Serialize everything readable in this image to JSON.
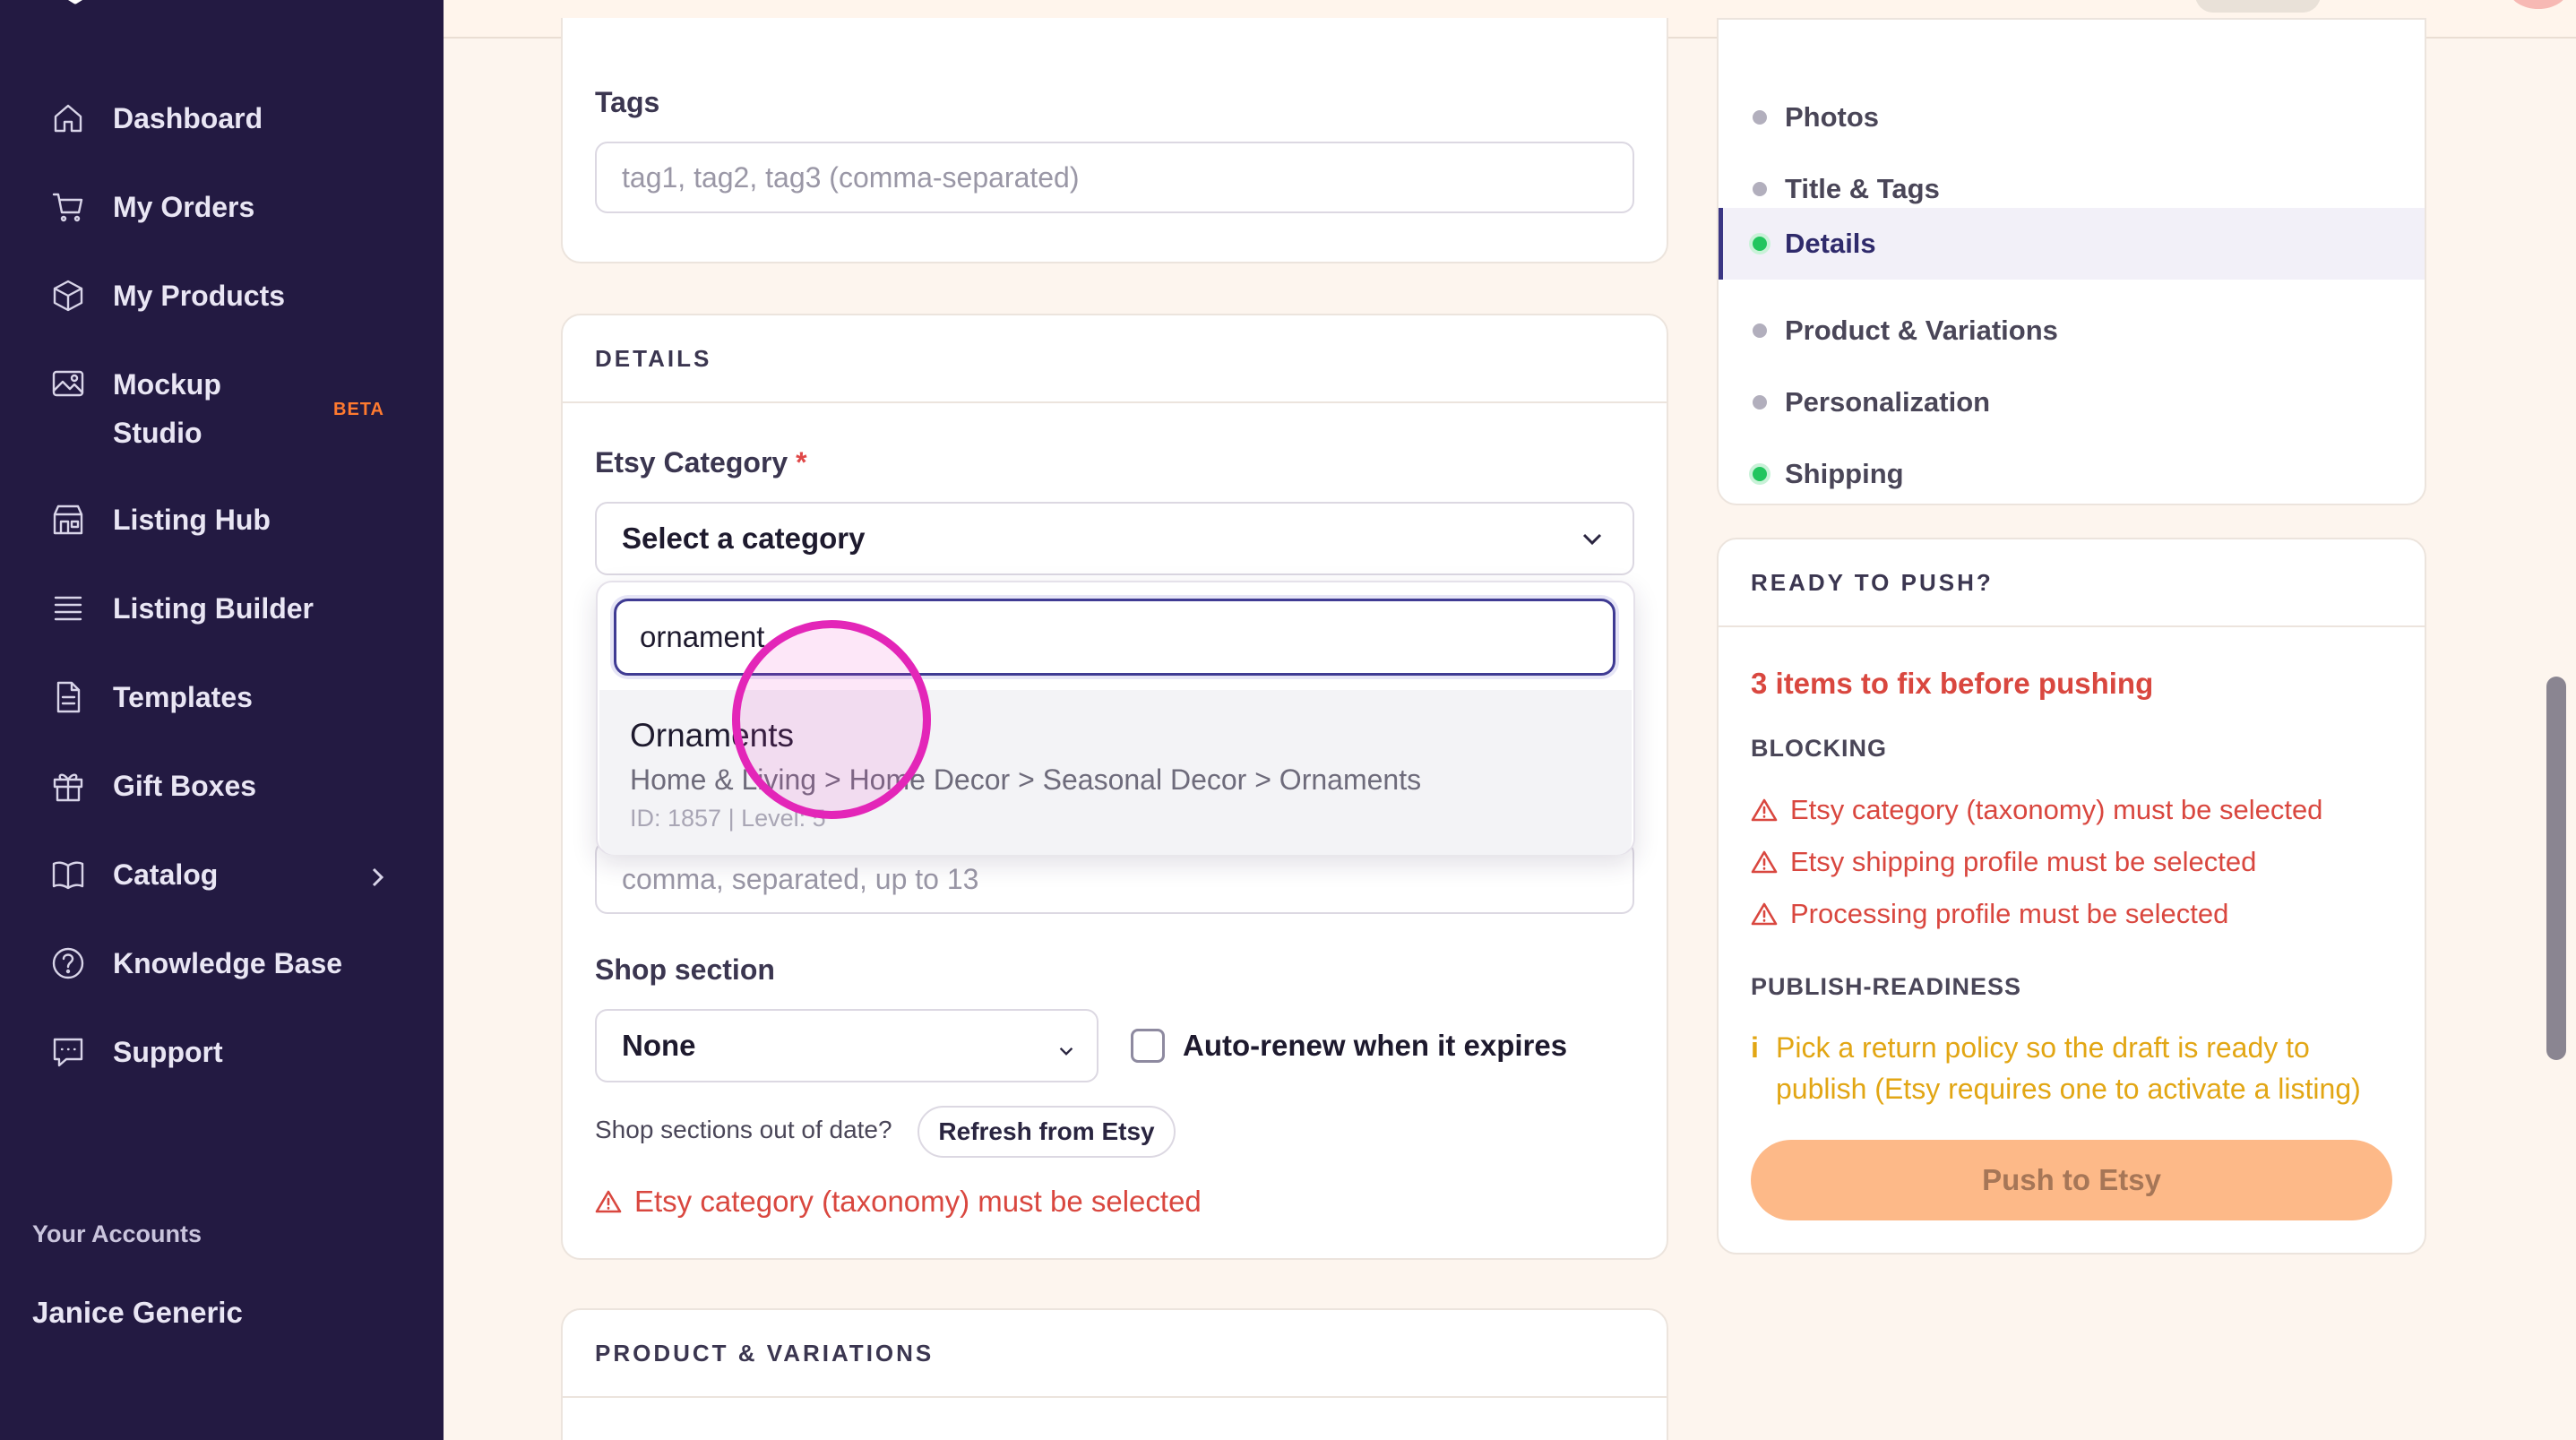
{
  "sidebar": {
    "items": [
      {
        "label": "Dashboard",
        "icon": "home-icon"
      },
      {
        "label": "My Orders",
        "icon": "cart-icon"
      },
      {
        "label": "My Products",
        "icon": "cube-icon"
      },
      {
        "label_line1": "Mockup",
        "label_line2": "Studio",
        "icon": "image-icon",
        "badge": "BETA"
      },
      {
        "label": "Listing Hub",
        "icon": "store-icon"
      },
      {
        "label": "Listing Builder",
        "icon": "list-icon"
      },
      {
        "label": "Templates",
        "icon": "document-icon"
      },
      {
        "label": "Gift Boxes",
        "icon": "gift-icon"
      },
      {
        "label": "Catalog",
        "icon": "book-icon"
      },
      {
        "label": "Knowledge Base",
        "icon": "help-icon"
      },
      {
        "label": "Support",
        "icon": "chat-icon"
      }
    ],
    "accounts_label": "Your Accounts",
    "account_name": "Janice Generic"
  },
  "tags_card": {
    "label": "Tags",
    "placeholder": "tag1, tag2, tag3 (comma-separated)"
  },
  "details_card": {
    "header": "DETAILS",
    "category_label": "Etsy Category",
    "required_mark": "*",
    "category_select_value": "Select a category",
    "dropdown": {
      "search_value": "ornament",
      "option_title": "Ornaments",
      "option_path": "Home & Living > Home Decor > Seasonal Decor > Ornaments",
      "option_meta": "ID: 1857 | Level: 5"
    },
    "hidden_input_placeholder": "comma, separated, up to 13",
    "shop_section_label": "Shop section",
    "shop_section_value": "None",
    "auto_renew_label": "Auto-renew when it expires",
    "out_of_date_text": "Shop sections out of date?",
    "refresh_button": "Refresh from Etsy",
    "error": "Etsy category (taxonomy) must be selected"
  },
  "product_card": {
    "header": "PRODUCT & VARIATIONS"
  },
  "progress": {
    "steps": [
      {
        "label": "Photos",
        "status": "gray"
      },
      {
        "label": "Title & Tags",
        "status": "gray"
      },
      {
        "label": "Details",
        "status": "green"
      },
      {
        "label": "Product & Variations",
        "status": "gray"
      },
      {
        "label": "Personalization",
        "status": "gray"
      },
      {
        "label": "Shipping",
        "status": "green"
      }
    ]
  },
  "ready": {
    "header": "READY TO PUSH?",
    "fix_title": "3 items to fix before pushing",
    "blocking_label": "BLOCKING",
    "blocking_items": [
      "Etsy category (taxonomy) must be selected",
      "Etsy shipping profile must be selected",
      "Processing profile must be selected"
    ],
    "readiness_label": "PUBLISH-READINESS",
    "readiness_line1": "Pick a return policy so the draft is ready to",
    "readiness_line2": "publish (Etsy requires one to activate a listing)",
    "info_icon": "i",
    "push_button": "Push to Etsy"
  },
  "colors": {
    "sidebar_bg": "#231a42",
    "page_bg": "#fdf5ee",
    "error": "#d9473f",
    "warning": "#e2a614",
    "push_button_bg": "#fdb988",
    "beta": "#ff7a2f",
    "active_dot": "#22c55e"
  }
}
